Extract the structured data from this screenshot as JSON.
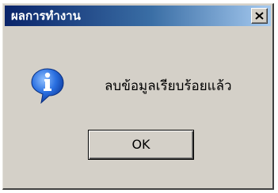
{
  "dialog": {
    "title": "ผลการทำงาน",
    "close_label": "×",
    "icon": "information-icon",
    "message": "ลบข้อมูลเรียบร้อยแล้ว",
    "ok_label": "OK"
  },
  "colors": {
    "title_bar_start": "#0a246a",
    "title_bar_end": "#a6caf0",
    "dialog_face": "#d4d0c8",
    "icon_blue": "#1e5fd0"
  }
}
